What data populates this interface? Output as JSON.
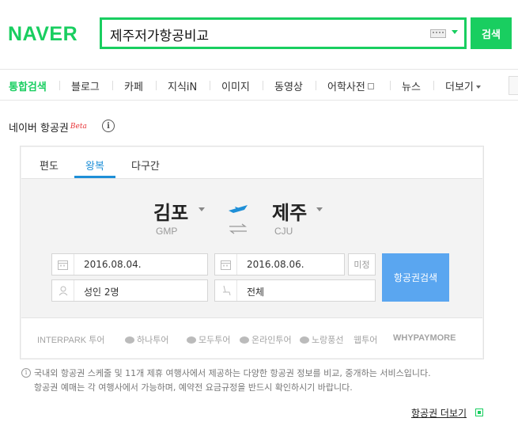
{
  "header": {
    "logo": "NAVER",
    "search_value": "제주저가항공비교",
    "search_button": "검색"
  },
  "nav": {
    "items": [
      "통합검색",
      "블로그",
      "카페",
      "지식iN",
      "이미지",
      "동영상",
      "어학사전",
      "뉴스",
      "더보기"
    ]
  },
  "section": {
    "title": "네이버 항공권",
    "badge": "Beta",
    "info_glyph": "i"
  },
  "widget": {
    "tabs": [
      "편도",
      "왕복",
      "다구간"
    ],
    "active_tab": "왕복",
    "origin": {
      "name": "김포",
      "code": "GMP"
    },
    "destination": {
      "name": "제주",
      "code": "CJU"
    },
    "depart_date": "2016.08.04.",
    "return_date": "2016.08.06.",
    "undecided_label": "미정",
    "passengers": "성인 2명",
    "seat_class": "전체",
    "search_button": "항공권검색",
    "accent_color": "#1e8fd7",
    "search_button_color": "#5aa6f0"
  },
  "partners": [
    "INTERPARK 투어",
    "하나투어",
    "모두투어",
    "온라인투어",
    "노랑풍선",
    "웹투어",
    "WHYPAYMORE"
  ],
  "notice": {
    "line1": "국내외 항공권 스케줄 및 11개 제휴 여행사에서 제공하는 다양한 항공권 정보를 비교, 중개하는 서비스입니다.",
    "line2": "항공권 예매는 각 여행사에서 가능하며, 예약전 요금규정을 반드시 확인하시기 바랍니다."
  },
  "more_link": "항공권 더보기",
  "brand_color": "#19ce60"
}
